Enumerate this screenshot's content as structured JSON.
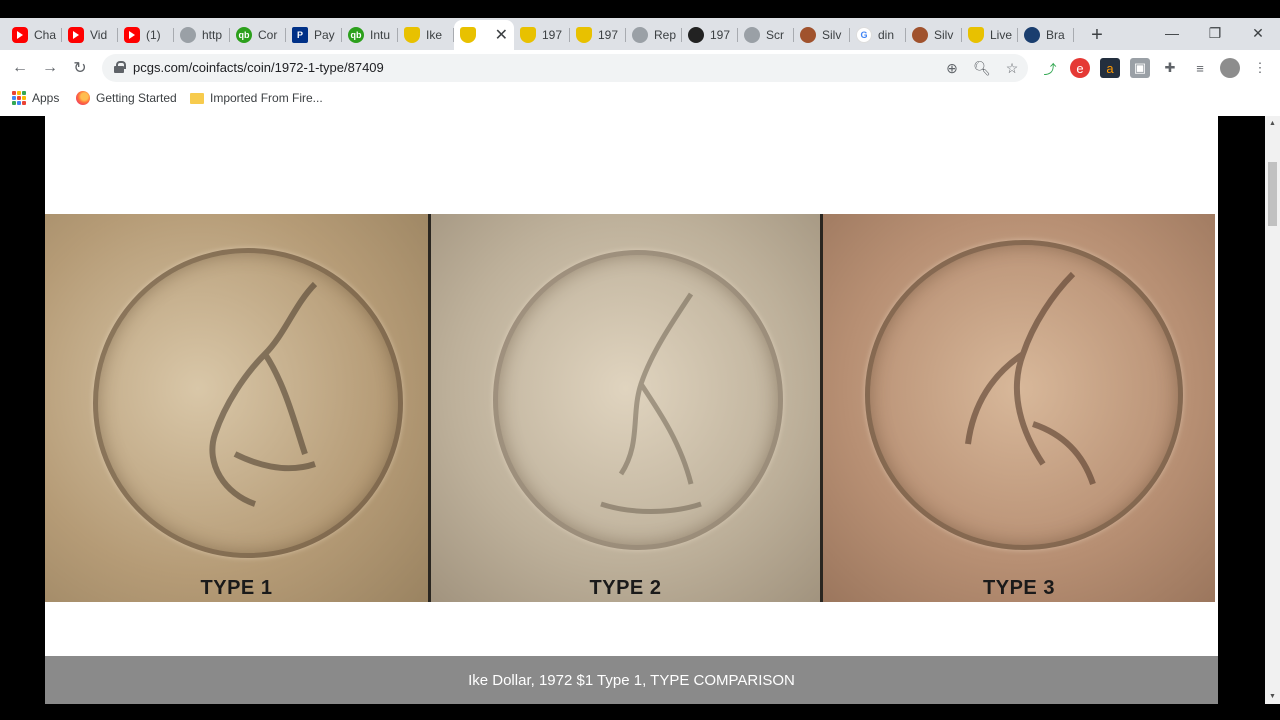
{
  "tabs": [
    {
      "label": "Cha",
      "icon": "youtube-icon"
    },
    {
      "label": "Vid",
      "icon": "youtube-icon"
    },
    {
      "label": "(1)",
      "icon": "youtube-icon"
    },
    {
      "label": "http",
      "icon": "globe-icon"
    },
    {
      "label": "Cor",
      "icon": "quickbooks-icon"
    },
    {
      "label": "Pay",
      "icon": "paypal-icon"
    },
    {
      "label": "Intu",
      "icon": "quickbooks-icon"
    },
    {
      "label": "Ike",
      "icon": "pcgs-shield-icon"
    },
    {
      "label": "",
      "icon": "pcgs-shield-icon",
      "active": true
    },
    {
      "label": "197",
      "icon": "pcgs-shield-icon"
    },
    {
      "label": "197",
      "icon": "pcgs-shield-icon"
    },
    {
      "label": "Rep",
      "icon": "globe-icon"
    },
    {
      "label": "197",
      "icon": "dark-circle-icon"
    },
    {
      "label": "Scr",
      "icon": "screenshot-icon"
    },
    {
      "label": "Silv",
      "icon": "coin-icon"
    },
    {
      "label": "din",
      "icon": "google-icon"
    },
    {
      "label": "Silv",
      "icon": "coin-icon"
    },
    {
      "label": "Live",
      "icon": "pcgs-shield-icon"
    },
    {
      "label": "Bra",
      "icon": "brave-icon"
    }
  ],
  "toolbar": {
    "url": "pcgs.com/coinfacts/coin/1972-1-type/87409"
  },
  "bookmarks": {
    "apps": "Apps",
    "getting_started": "Getting Started",
    "imported": "Imported From Fire..."
  },
  "page": {
    "coin_labels": [
      "TYPE 1",
      "TYPE 2",
      "TYPE 3"
    ],
    "caption": "Ike Dollar, 1972 $1 Type 1, TYPE COMPARISON"
  }
}
